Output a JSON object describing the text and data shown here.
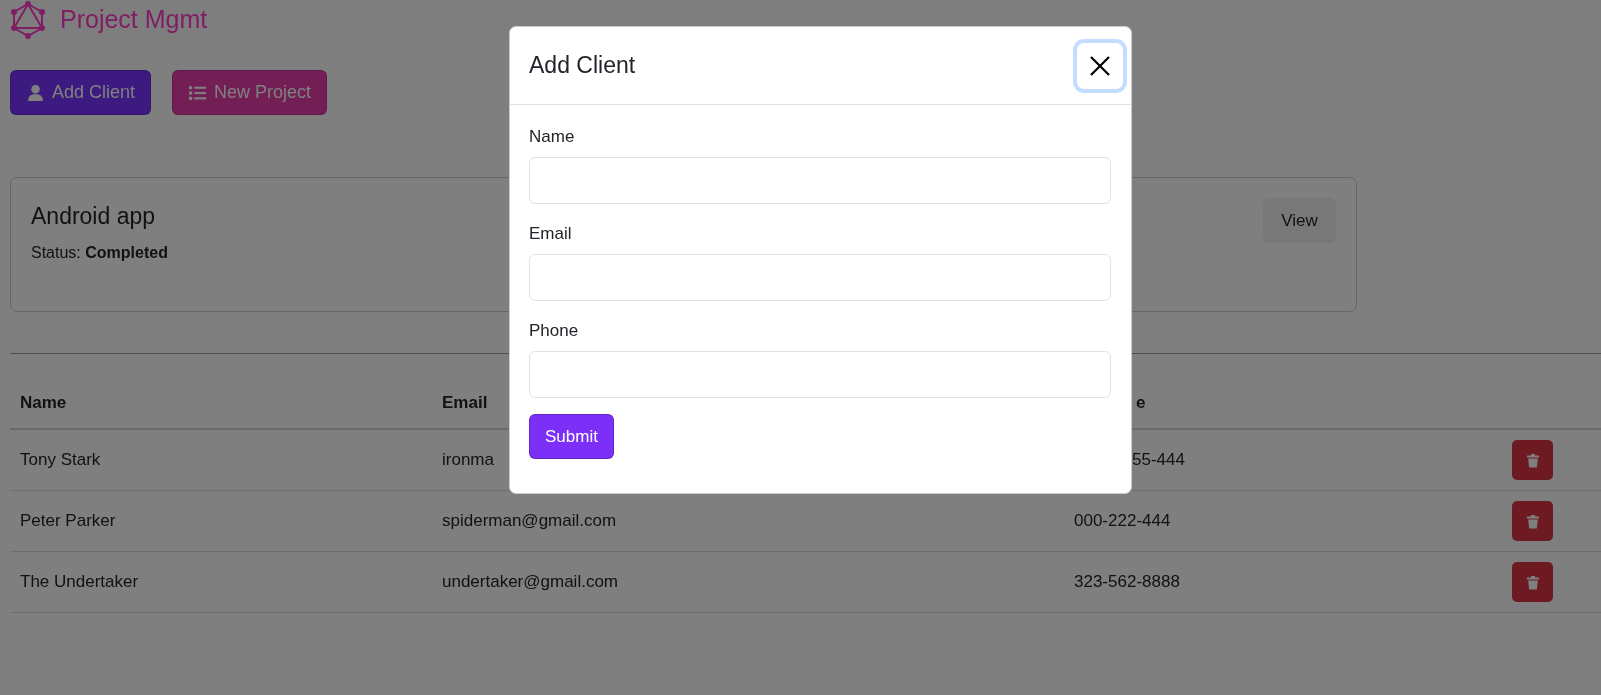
{
  "navbar": {
    "title": "Project Mgmt"
  },
  "actions": [
    {
      "label": "Add Client",
      "kind": "client"
    },
    {
      "label": "New Project",
      "kind": "project"
    }
  ],
  "projects": [
    {
      "name": "Android app",
      "status": "Status: **Completed**",
      "action": "View"
    }
  ],
  "table": {
    "columns": [
      "Name",
      "Email",
      "e"
    ],
    "rows": [
      {
        "name": "Tony Stark",
        "email": "ironma",
        "phone": "55-444"
      },
      {
        "name": "Peter Parker",
        "email": "spiderman@gmail.com",
        "phone": "000-222-444"
      },
      {
        "name": "The Undertaker",
        "email": "undertaker@gmail.com",
        "phone": "323-562-8888"
      }
    ]
  },
  "modal": {
    "title": "Add Client",
    "close_focused": true,
    "fields": [
      {
        "label": "Name"
      },
      {
        "label": "Email"
      },
      {
        "label": "Phone"
      }
    ],
    "submit": "Submit"
  }
}
